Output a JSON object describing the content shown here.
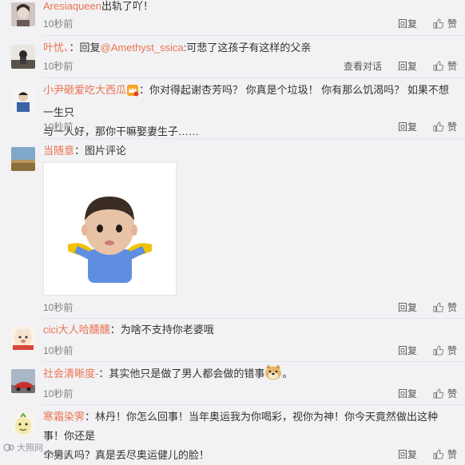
{
  "comments": [
    {
      "user": "Aresiaqueen",
      "body": "出轨了吖！",
      "time": "10秒前",
      "reply": "回复",
      "like": "赞"
    },
    {
      "user": "叶忧、",
      "prefix": "：回复",
      "mention": "@Amethyst_ssica",
      "body": ":可悲了这孩子有这样的父亲",
      "time": "10秒前",
      "view": "查看对话",
      "reply": "回复",
      "like": "赞"
    },
    {
      "user": "小尹砸爱吃大西瓜",
      "body_line1": "：你对得起谢杏芳吗？ 你真是个垃圾！ 你有那么饥渴吗？ 如果不想一生只",
      "body_line2": "与一人好，那你干嘛娶妻生子……",
      "time": "10秒前",
      "reply": "回复",
      "like": "赞"
    },
    {
      "user": "当随意",
      "body": "：图片评论",
      "time": "10秒前",
      "reply": "回复",
      "like": "赞"
    },
    {
      "user": "cici大人哈醺醺",
      "body": "：为啥不支持你老婆哦",
      "time": "10秒前",
      "reply": "回复",
      "like": "赞"
    },
    {
      "user": "社会清晰度-",
      "body": "：其实他只是做了男人都会做的错事",
      "time": "10秒前",
      "reply": "回复",
      "like": "赞"
    },
    {
      "user": "寒霜染霁",
      "body_line1": "：林丹！你怎么回事！当年奥运我为你喝彩，视你为神！你今天竟然做出这种事！你还是",
      "body_line2": "个男人吗？真是丢尽奥运健儿的脸！",
      "time": "10秒前",
      "reply": "回复",
      "like": "赞"
    }
  ],
  "watermark": "大照网"
}
